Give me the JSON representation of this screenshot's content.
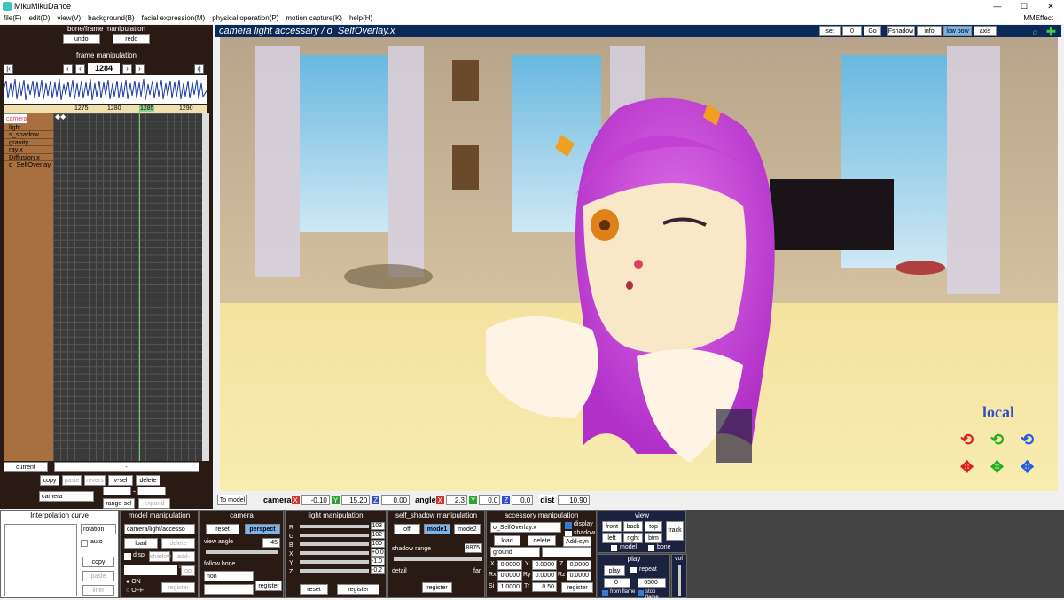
{
  "window": {
    "title": "MikuMikuDance",
    "min": "—",
    "max": "☐",
    "close": "✕"
  },
  "menu": [
    "file(F)",
    "edit(D)",
    "view(V)",
    "background(B)",
    "facial expression(M)",
    "physical operation(P)",
    "motion capture(K)",
    "help(H)"
  ],
  "menu_right": "MMEffect",
  "left": {
    "header": "bone/frame manipulation",
    "undo": "undo",
    "redo": "redo",
    "frame_header": "frame manipulation",
    "frame": "1284",
    "ruler": [
      "1275",
      "1280",
      "1285",
      "1290"
    ],
    "tracks": [
      "camera",
      "light",
      "s_shadow",
      "gravity",
      "ray.x",
      "Diffusion.x",
      "o_SelfOverlay"
    ],
    "current": "current",
    "copy": "copy",
    "paste": "paste",
    "revers": "revers",
    "vsel": "v-sel",
    "delete": "delete",
    "camera_sel": "camera",
    "range": "range-sel",
    "expand": "expand",
    "dash": "-"
  },
  "viewport": {
    "title": "camera light accessary / o_SelfOverlay.x",
    "set": "set",
    "frame": "0",
    "go": "Go",
    "fshadow": "Fshadow",
    "info": "info",
    "lowpow": "low pow",
    "axis": "axis",
    "local": "local"
  },
  "status": {
    "tomodel": "To model",
    "camera": "camera",
    "cx": "-0.10",
    "cy": "15.20",
    "cz": "0.00",
    "angle": "angle",
    "ax": "2.3",
    "ay": "0.0",
    "az": "0.0",
    "dist": "dist",
    "dval": "10.90",
    "X": "X",
    "Y": "Y",
    "Z": "Z"
  },
  "interp": {
    "title": "Interpolation curve",
    "rotation": "rotation",
    "auto": "auto",
    "copy": "copy",
    "paste": "paste",
    "liner": "liner"
  },
  "model": {
    "title": "model manipulation",
    "sel": "camera/light/accesso",
    "load": "load",
    "delete": "delete",
    "disp": "disp",
    "shadow": "shadow",
    "addsyn": "add-syn",
    "op": "op",
    "on": "ON",
    "off": "OFF",
    "register": "register"
  },
  "camera": {
    "title": "camera",
    "reset": "reset",
    "perspect": "perspect",
    "view_angle": "view angle",
    "va": "45",
    "follow": "follow bone",
    "non": "non",
    "register": "register"
  },
  "light": {
    "title": "light manipulation",
    "rows": [
      {
        "l": "R",
        "v": "103"
      },
      {
        "l": "G",
        "v": "102"
      },
      {
        "l": "B",
        "v": "100"
      },
      {
        "l": "X",
        "v": "+0.0"
      },
      {
        "l": "Y",
        "v": "-1.0"
      },
      {
        "l": "Z",
        "v": "-0.2"
      }
    ],
    "reset": "reset",
    "register": "register"
  },
  "shadow": {
    "title": "self_shadow manipulation",
    "off": "off",
    "mode1": "mode1",
    "mode2": "mode2",
    "range": "shadow range",
    "rv": "8875",
    "detail": "detail",
    "far": "far",
    "register": "register"
  },
  "accessory": {
    "title": "accessory manipulation",
    "sel": "o_SelfOverlay.x",
    "display": "display",
    "shadow": "shadow",
    "load": "load",
    "delete": "delete",
    "addsyn": "Add-syn",
    "ground": "ground",
    "x": "0.0000",
    "y": "0.0000",
    "z": "0.0000",
    "rx": "0.0000",
    "ry": "0.0000",
    "rz": "0.0000",
    "si": "1.0000",
    "tr": "0.50",
    "register": "register",
    "X": "X",
    "Y": "Y",
    "Z": "Z",
    "Rx": "Rx",
    "Ry": "Ry",
    "Rz": "Rz",
    "Si": "Si",
    "Tr": "Tr"
  },
  "view": {
    "title": "view",
    "front": "front",
    "back": "back",
    "top": "top",
    "left": "left",
    "right": "right",
    "btm": "btm",
    "track": "track",
    "model": "model",
    "bone": "bone"
  },
  "play": {
    "title": "play",
    "play": "play",
    "repeat": "repeat",
    "from": "0",
    "to": "6500",
    "dash": "-",
    "fromflame": "from flame",
    "stopflame": "stop flame",
    "vol": "vol"
  }
}
